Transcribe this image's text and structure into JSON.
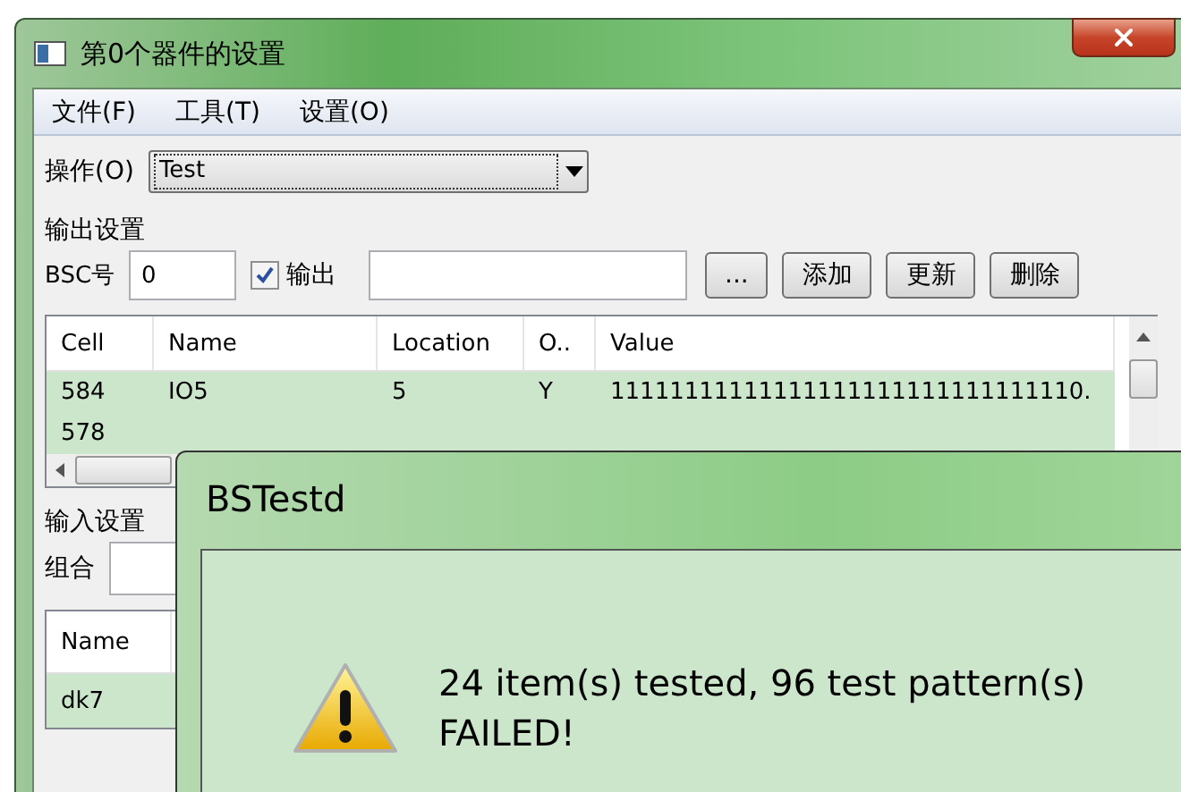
{
  "window": {
    "title": "第0个器件的设置"
  },
  "menu": [
    "文件(F)",
    "工具(T)",
    "设置(O)"
  ],
  "operation": {
    "label": "操作(O)",
    "value": "Test"
  },
  "output_settings": {
    "heading": "输出设置",
    "bsc_label": "BSC号",
    "bsc_value": "0",
    "output_checkbox": {
      "label": "输出",
      "checked": true
    },
    "browse_button": "...",
    "buttons": [
      "添加",
      "更新",
      "删除"
    ]
  },
  "output_table": {
    "columns": [
      "Cell",
      "Name",
      "Location",
      "O..",
      "Value"
    ],
    "rows": [
      [
        "584",
        "IO5",
        "5",
        "Y",
        "11111111111111111111111111111110."
      ],
      [
        "578"
      ]
    ]
  },
  "input_settings": {
    "heading": "输入设置",
    "combo_label": "组合"
  },
  "input_table": {
    "columns": [
      "Name"
    ],
    "rows": [
      [
        "dk7"
      ]
    ]
  },
  "dialog": {
    "title": "BSTestd",
    "message": [
      "24 item(s) tested, 96 test pattern(s)",
      "FAILED!"
    ]
  }
}
